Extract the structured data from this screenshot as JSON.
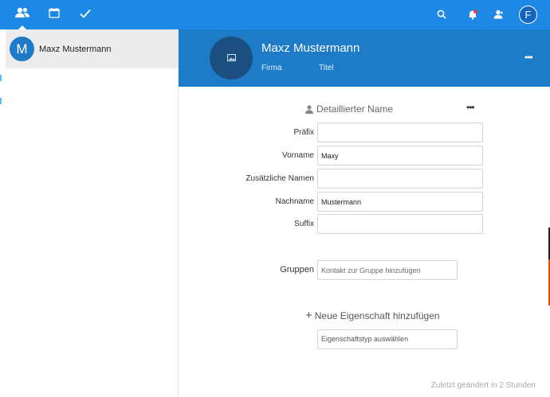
{
  "topbar": {
    "tabs": [
      {
        "name": "contacts",
        "icon": "contacts-icon",
        "active": true
      },
      {
        "name": "calendar",
        "icon": "calendar-icon",
        "active": false
      },
      {
        "name": "tasks",
        "icon": "checkmark-icon",
        "active": false
      }
    ],
    "user_initial": "F",
    "accent": "#1e88e5"
  },
  "sidebar": {
    "contacts": [
      {
        "initial": "M",
        "name": "Maxz Mustermann",
        "selected": true
      }
    ]
  },
  "contact": {
    "display_name": "Maxz Mustermann",
    "company_placeholder": "Firma",
    "title_placeholder": "Titel",
    "more": "•••"
  },
  "details": {
    "section_title": "Detaillierter Name",
    "more": "•••",
    "fields": {
      "prefix": {
        "label": "Präfix",
        "value": ""
      },
      "first": {
        "label": "Vorname",
        "value": "Maxy"
      },
      "additional": {
        "label": "Zusätzliche Namen",
        "value": ""
      },
      "last": {
        "label": "Nachname",
        "value": "Mustermann"
      },
      "suffix": {
        "label": "Suffix",
        "value": ""
      }
    },
    "groups": {
      "label": "Gruppen",
      "placeholder": "Kontakt zur Gruppe hinzufügen"
    },
    "add_property": {
      "label": "Neue Eigenschaft hinzufügen",
      "select_placeholder": "Eigenschaftstyp auswählen"
    },
    "last_modified": "Zuletzt geändert in 2 Stunden"
  }
}
